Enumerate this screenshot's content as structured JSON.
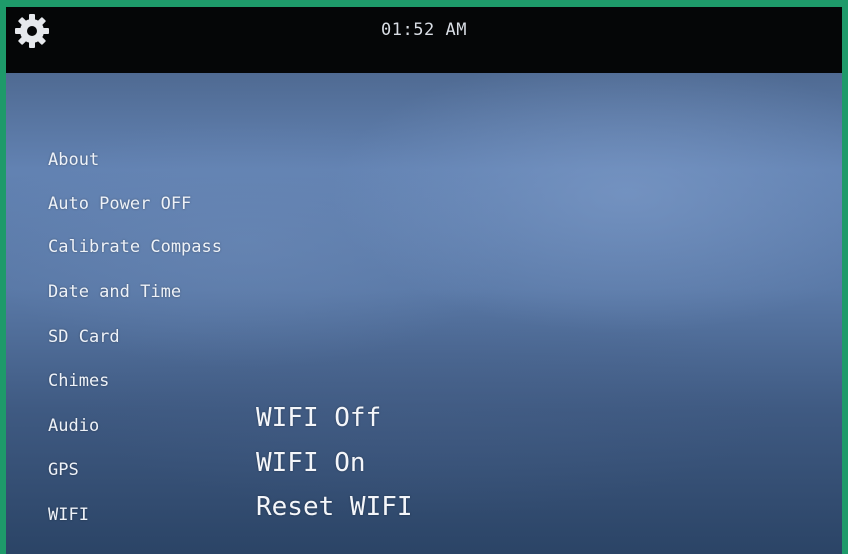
{
  "header": {
    "settings_icon": "gear-icon",
    "time": "01:52 AM"
  },
  "menu": {
    "items": [
      {
        "label": "About"
      },
      {
        "label": "Auto Power OFF"
      },
      {
        "label": "Calibrate Compass"
      },
      {
        "label": "Date and Time"
      },
      {
        "label": "SD Card"
      },
      {
        "label": "Chimes"
      },
      {
        "label": "Audio"
      },
      {
        "label": "GPS"
      },
      {
        "label": "WIFI"
      }
    ]
  },
  "wifi_submenu": {
    "options": [
      {
        "label": "WIFI Off"
      },
      {
        "label": "WIFI On"
      },
      {
        "label": "Reset WIFI"
      }
    ]
  },
  "colors": {
    "frame_border": "#1e9a6a",
    "topbar": "#050607",
    "screen_blue": "#5a79a7",
    "text": "#eef2f8"
  }
}
